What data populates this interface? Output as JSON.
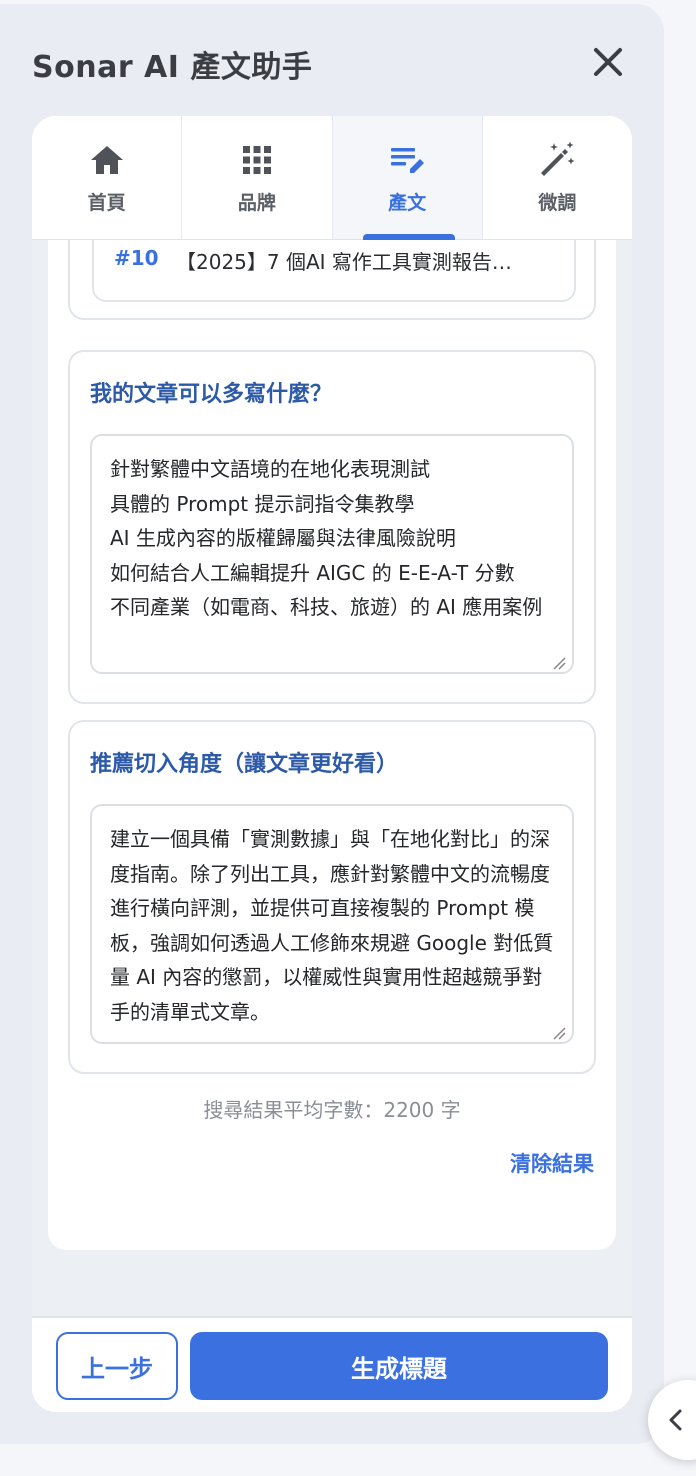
{
  "app": {
    "title": "Sonar AI 產文助手"
  },
  "tabs": [
    {
      "label": "首頁",
      "icon": "home-icon",
      "active": false
    },
    {
      "label": "品牌",
      "icon": "grid-icon",
      "active": false
    },
    {
      "label": "產文",
      "icon": "edit-list-icon",
      "active": true
    },
    {
      "label": "微調",
      "icon": "magic-wand-icon",
      "active": false
    }
  ],
  "ranking": {
    "number": "#10",
    "title": "【2025】7 個AI 寫作工具實測報告…"
  },
  "more_topics": {
    "title": "我的文章可以多寫什麼？",
    "value": "針對繁體中文語境的在地化表現測試\n具體的 Prompt 提示詞指令集教學\nAI 生成內容的版權歸屬與法律風險說明\n如何結合人工編輯提升 AIGC 的 E-E-A-T 分數\n不同產業（如電商、科技、旅遊）的 AI 應用案例"
  },
  "angle": {
    "title": "推薦切入角度（讓文章更好看）",
    "value": "建立一個具備「實測數據」與「在地化對比」的深度指南。除了列出工具，應針對繁體中文的流暢度進行橫向評測，並提供可直接複製的 Prompt 模板，強調如何透過人工修飾來規避 Google 對低質量 AI 內容的懲罰，以權威性與實用性超越競爭對手的清單式文章。"
  },
  "avg_words": "搜尋結果平均字數：2200 字",
  "clear_label": "清除結果",
  "footer": {
    "prev_label": "上一步",
    "generate_label": "生成標題"
  },
  "colors": {
    "accent": "#3a70df",
    "section_title": "#2c5aa8"
  }
}
